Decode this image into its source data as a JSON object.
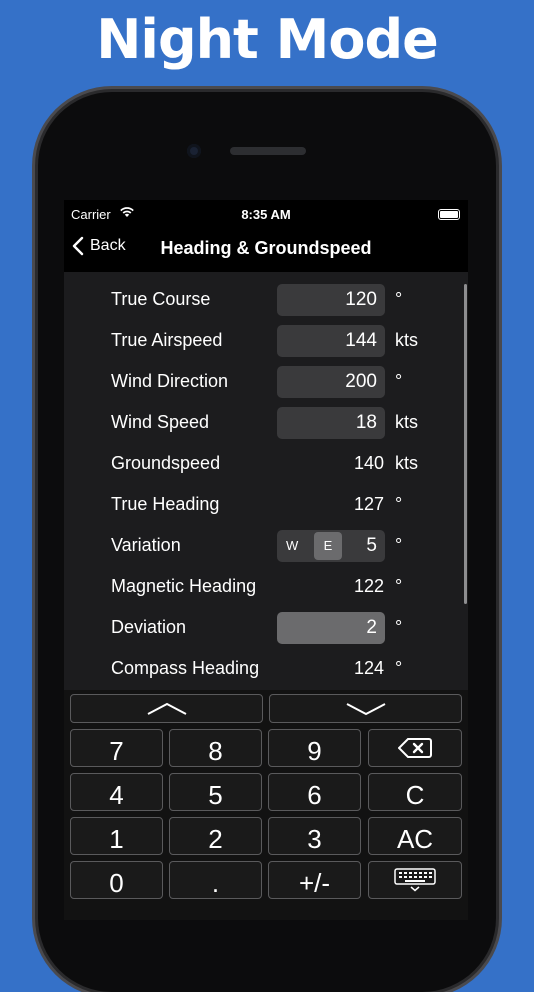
{
  "banner": {
    "title": "Night Mode"
  },
  "status": {
    "carrier": "Carrier",
    "time": "8:35 AM"
  },
  "nav": {
    "back_label": "Back",
    "title": "Heading & Groundspeed"
  },
  "rows": [
    {
      "label": "True Course",
      "value": "120",
      "unit": "°"
    },
    {
      "label": "True Airspeed",
      "value": "144",
      "unit": "kts"
    },
    {
      "label": "Wind Direction",
      "value": "200",
      "unit": "°"
    },
    {
      "label": "Wind Speed",
      "value": "18",
      "unit": "kts"
    },
    {
      "label": "Groundspeed",
      "value": "140",
      "unit": "kts"
    },
    {
      "label": "True Heading",
      "value": "127",
      "unit": "°"
    },
    {
      "label": "Variation",
      "west": "W",
      "east": "E",
      "value": "5",
      "unit": "°"
    },
    {
      "label": "Magnetic Heading",
      "value": "122",
      "unit": "°"
    },
    {
      "label": "Deviation",
      "value": "2",
      "unit": "°"
    },
    {
      "label": "Compass Heading",
      "value": "124",
      "unit": "°"
    }
  ],
  "keypad": {
    "up_icon": "chevron-up-icon",
    "down_icon": "chevron-down-icon",
    "keys": [
      "7",
      "8",
      "9",
      "4",
      "5",
      "6",
      "C",
      "1",
      "2",
      "3",
      "AC",
      "0",
      ".",
      "+/-"
    ],
    "backspace_icon": "backspace-icon",
    "keyboard_icon": "keyboard-hide-icon"
  },
  "colors": {
    "background": "#3571c8",
    "form": "#1c1c1e",
    "field": "#3a3a3c",
    "field_active": "#6b6b6d"
  }
}
